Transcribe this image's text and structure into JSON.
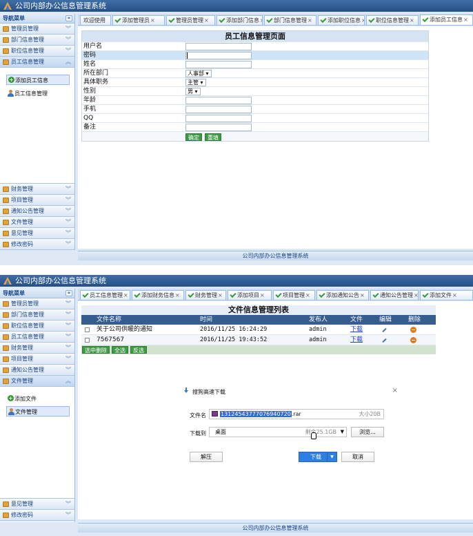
{
  "app_title": "公司内部办公信息管理系统",
  "sidebar_header": "导航菜单",
  "collapse_icon": "«",
  "footer_text": "公司内部办公信息管理系统",
  "screen1": {
    "menu_top": [
      "管理员管理",
      "部门信息管理",
      "职位信息管理",
      "员工信息管理"
    ],
    "submenu": [
      "添加员工信息",
      "员工信息管理"
    ],
    "menu_bottom": [
      "财务管理",
      "项目管理",
      "通知公告管理",
      "文件管理",
      "意见管理",
      "修改密码"
    ],
    "tabs": [
      "欢迎使用",
      "添加管理员",
      "管理员管理",
      "添加部门信息",
      "部门信息管理",
      "添加职位信息",
      "职位信息管理",
      "添加员工信息"
    ],
    "form": {
      "title": "员工信息管理页面",
      "fields": [
        "用户名",
        "密码",
        "姓名",
        "所在部门",
        "具体职务",
        "性别",
        "年龄",
        "手机",
        "QQ",
        "备注"
      ],
      "dept_value": "人事部",
      "job_value": "主管",
      "gender_value": "男",
      "confirm": "确定",
      "reset": "重填"
    }
  },
  "screen2": {
    "menu_top": [
      "管理员管理",
      "部门信息管理",
      "职位信息管理",
      "员工信息管理",
      "财务管理",
      "项目管理",
      "通知公告管理",
      "文件管理"
    ],
    "submenu": [
      "添加文件",
      "文件管理"
    ],
    "menu_bottom": [
      "意见管理",
      "修改密码"
    ],
    "tabs": [
      "员工信息管理",
      "添加财务信息",
      "财务管理",
      "添加项目",
      "项目管理",
      "添加通知公告",
      "通知公告管理",
      "添加文件"
    ],
    "table": {
      "title": "文件信息管理列表",
      "headers": [
        "文件名称",
        "时间",
        "发布人",
        "文件",
        "编辑",
        "删除"
      ],
      "rows": [
        {
          "name": "关于公司供暖的通知",
          "time": "2016/11/25 16:24:29",
          "author": "admin",
          "file": "下载"
        },
        {
          "name": "7567567",
          "time": "2016/11/25 19:43:52",
          "author": "admin",
          "file": "下载"
        }
      ],
      "btn_delete_selected": "选中删除",
      "btn_select_all": "全选",
      "btn_invert": "反选"
    },
    "dialog": {
      "title": "搜狗高速下载",
      "filename_label": "文件名",
      "filename_selected": "131245437770769407​20",
      "filename_ext": ".rar",
      "size": "大小20B",
      "saveto_label": "下载到",
      "saveto_value": "桌面",
      "remaining": "剩余25.1GB",
      "browse": "浏览...",
      "unzip": "解压",
      "download": "下载",
      "cancel": "取消"
    }
  }
}
